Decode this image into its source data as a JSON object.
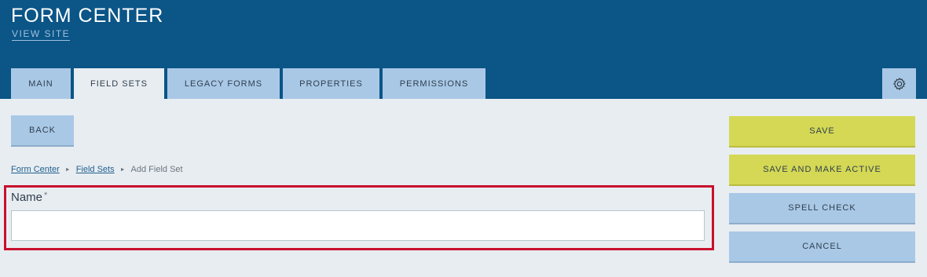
{
  "header": {
    "title": "FORM CENTER",
    "view_site": "VIEW SITE"
  },
  "tabs": [
    {
      "label": "MAIN",
      "active": false
    },
    {
      "label": "FIELD SETS",
      "active": true
    },
    {
      "label": "LEGACY FORMS",
      "active": false
    },
    {
      "label": "PROPERTIES",
      "active": false
    },
    {
      "label": "PERMISSIONS",
      "active": false
    }
  ],
  "settings_icon": "gear-icon",
  "back_label": "BACK",
  "breadcrumb": {
    "items": [
      "Form Center",
      "Field Sets"
    ],
    "current": "Add Field Set",
    "separator": "►"
  },
  "form": {
    "name_label": "Name",
    "required_mark": "*",
    "name_value": "",
    "highlight_color": "#c8102e"
  },
  "actions": {
    "save": "SAVE",
    "save_active": "SAVE AND MAKE ACTIVE",
    "spell_check": "SPELL CHECK",
    "cancel": "CANCEL"
  },
  "colors": {
    "header_bg": "#0b5587",
    "tab_bg": "#a9c8e6",
    "save_bg": "#d4d854",
    "page_bg": "#e8edf1"
  }
}
